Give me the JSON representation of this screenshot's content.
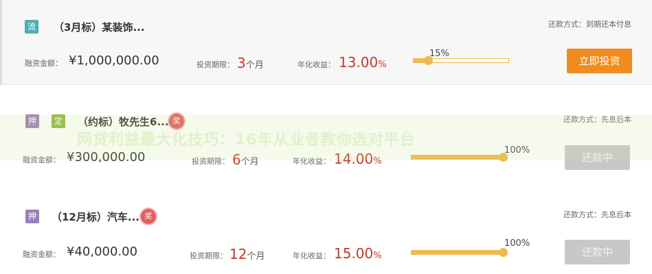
{
  "loans": [
    {
      "tags": [
        "流"
      ],
      "title": "（3月标）某装饰...",
      "badge": "",
      "repay_method": "还款方式：到期还本付息",
      "amount_label": "融资金额：",
      "amount": "¥1,000,000.00",
      "term_label": "投资期限：",
      "term_num": "3",
      "term_unit": "个月",
      "yield_label": "年化收益：",
      "yield_num": "13.00",
      "yield_unit": "%",
      "progress": "15%",
      "progress_value": 15,
      "button": "立即投资",
      "button_state": "active"
    },
    {
      "tags": [
        "押",
        "定"
      ],
      "title": "（约标）牧先生6...",
      "badge": "奖",
      "repay_method": "还款方式：先息后本",
      "amount_label": "融资金额：",
      "amount": "¥300,000.00",
      "term_label": "投资期限：",
      "term_num": "6",
      "term_unit": "个月",
      "yield_label": "年化收益：",
      "yield_num": "14.00",
      "yield_unit": "%",
      "progress": "100%",
      "progress_value": 100,
      "button": "还款中",
      "button_state": "disabled"
    },
    {
      "tags": [
        "押"
      ],
      "title": "（12月标）汽车...",
      "badge": "奖",
      "repay_method": "还款方式：先息后本",
      "amount_label": "融资金额：",
      "amount": "¥40,000.00",
      "term_label": "投资期限：",
      "term_num": "12",
      "term_unit": "个月",
      "yield_label": "年化收益：",
      "yield_num": "15.00",
      "yield_unit": "%",
      "progress": "100%",
      "progress_value": 100,
      "button": "还款中",
      "button_state": "disabled"
    }
  ],
  "watermark": "网贷利益最大化技巧：16年从业者教你选对平台",
  "colors": {
    "accent_orange": "#f08c1e",
    "progress": "#f0b94d",
    "highlight_red": "#c0392b",
    "disabled_gray": "#c8c8c8"
  }
}
